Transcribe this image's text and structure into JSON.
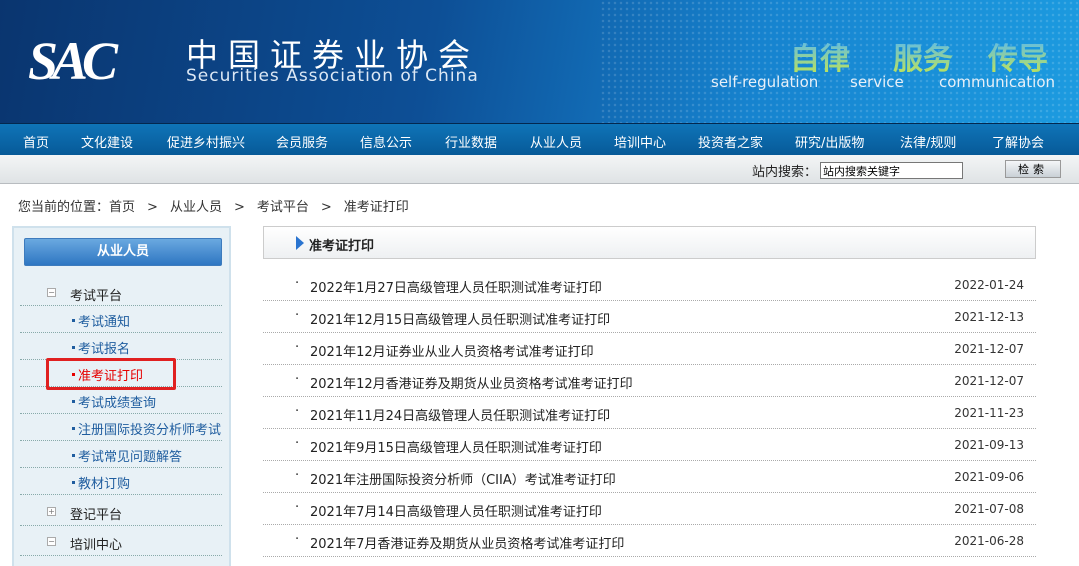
{
  "header": {
    "logo": "SAC",
    "cn_name": "中国证券业协会",
    "en_name": "Securities Association of China",
    "slogans": [
      {
        "cn": "自律",
        "en": "self-regulation"
      },
      {
        "cn": "服务",
        "en": "service"
      },
      {
        "cn": "传导",
        "en": "communication"
      }
    ]
  },
  "nav": [
    "首页",
    "文化建设",
    "促进乡村振兴",
    "会员服务",
    "信息公示",
    "行业数据",
    "从业人员",
    "培训中心",
    "投资者之家",
    "研究/出版物",
    "法律/规则",
    "了解协会"
  ],
  "search": {
    "label": "站内搜索：",
    "value": "站内搜索关键字",
    "button": "检索"
  },
  "breadcrumb": {
    "prefix": "您当前的位置：",
    "items": [
      "首页",
      "从业人员",
      "考试平台",
      "准考证打印"
    ],
    "sep": ">"
  },
  "sidebar": {
    "title": "从业人员",
    "groups": [
      {
        "label": "考试平台",
        "expanded": true
      },
      {
        "label": "登记平台",
        "expanded": false
      },
      {
        "label": "培训中心",
        "expanded": true
      }
    ],
    "links": [
      "考试通知",
      "考试报名",
      "准考证打印",
      "考试成绩查询",
      "注册国际投资分析师考试",
      "考试常见问题解答",
      "教材订购"
    ],
    "active": "准考证打印",
    "toggle_minus": "−",
    "toggle_plus": "+"
  },
  "main": {
    "title": "准考证打印",
    "bullet": "·",
    "items": [
      {
        "title": "2022年1月27日高级管理人员任职测试准考证打印",
        "date": "2022-01-24"
      },
      {
        "title": "2021年12月15日高级管理人员任职测试准考证打印",
        "date": "2021-12-13"
      },
      {
        "title": "2021年12月证券业从业人员资格考试准考证打印",
        "date": "2021-12-07"
      },
      {
        "title": "2021年12月香港证券及期货从业员资格考试准考证打印",
        "date": "2021-12-07"
      },
      {
        "title": "2021年11月24日高级管理人员任职测试准考证打印",
        "date": "2021-11-23"
      },
      {
        "title": "2021年9月15日高级管理人员任职测试准考证打印",
        "date": "2021-09-13"
      },
      {
        "title": "2021年注册国际投资分析师（CIIA）考试准考证打印",
        "date": "2021-09-06"
      },
      {
        "title": "2021年7月14日高级管理人员任职测试准考证打印",
        "date": "2021-07-08"
      },
      {
        "title": "2021年7月香港证券及期货从业员资格考试准考证打印",
        "date": "2021-06-28"
      }
    ]
  },
  "colors": {
    "nav_bg": "#0b6bb0",
    "link": "#1f5d9f",
    "active": "#e60000",
    "highlight_box": "#e02020"
  }
}
